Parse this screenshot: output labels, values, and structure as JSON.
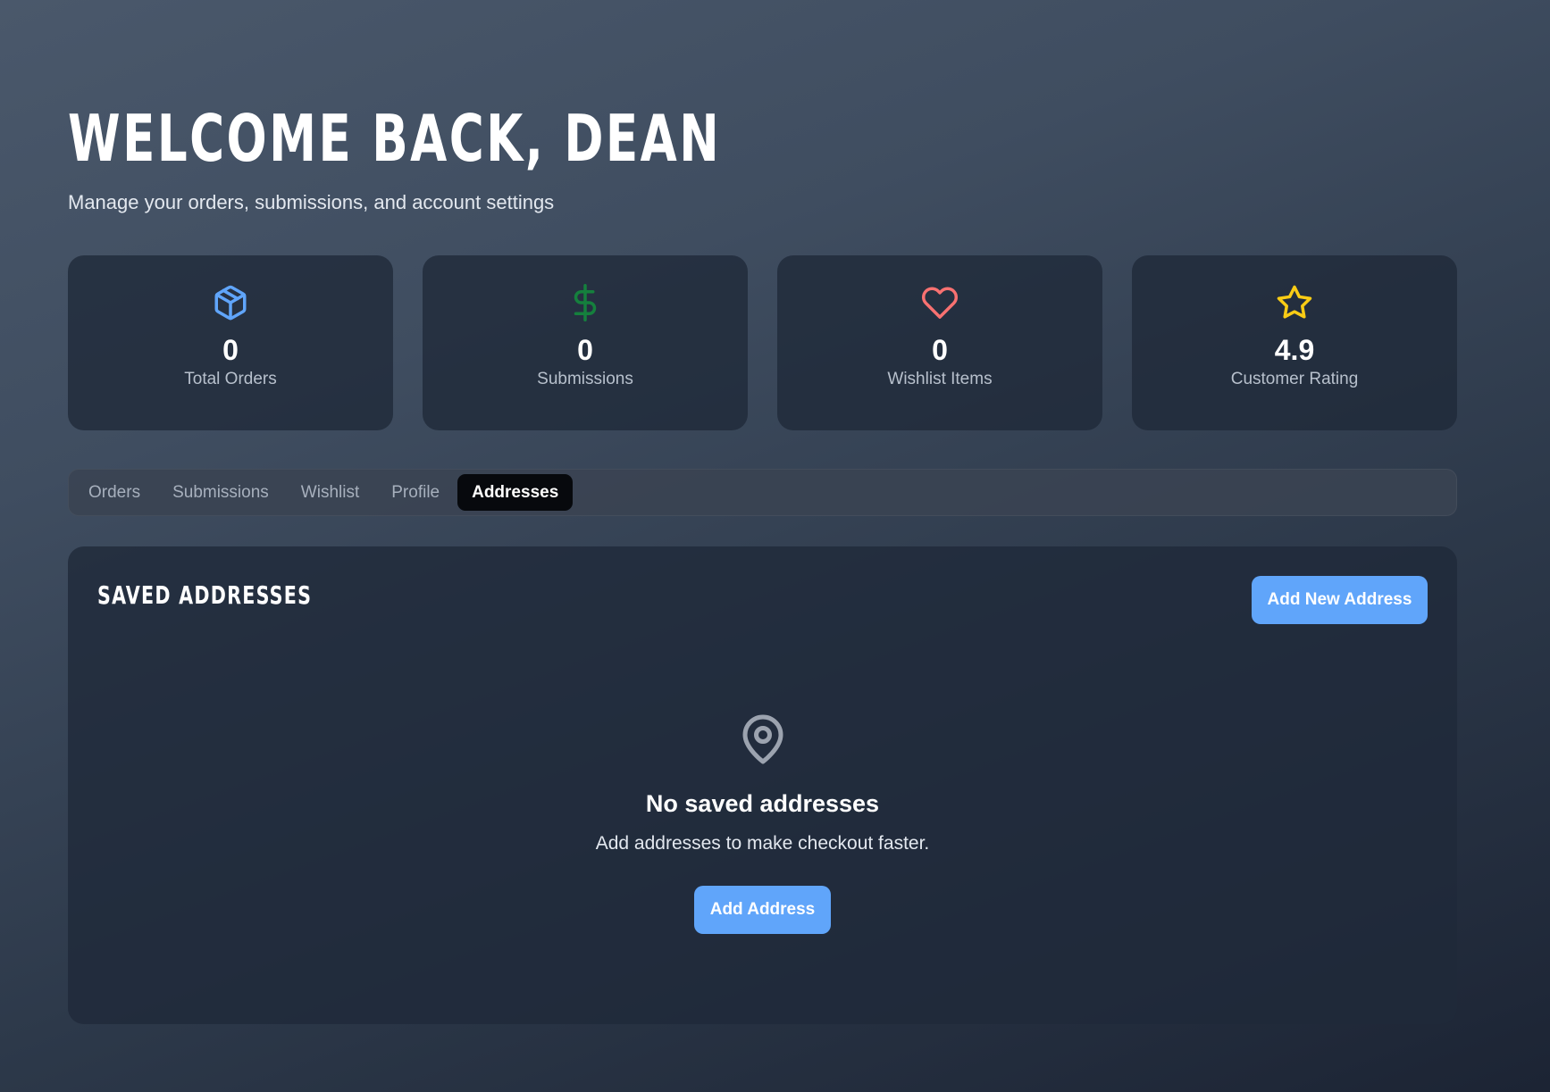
{
  "header": {
    "title": "WELCOME BACK, DEAN",
    "subtitle": "Manage your orders, submissions, and account settings"
  },
  "stats": [
    {
      "icon": "package-icon",
      "color": "#60a5fa",
      "value": "0",
      "label": "Total Orders"
    },
    {
      "icon": "dollar-icon",
      "color": "#15803d",
      "value": "0",
      "label": "Submissions"
    },
    {
      "icon": "heart-icon",
      "color": "#f87171",
      "value": "0",
      "label": "Wishlist Items"
    },
    {
      "icon": "star-icon",
      "color": "#facc15",
      "value": "4.9",
      "label": "Customer Rating"
    }
  ],
  "tabs": [
    {
      "label": "Orders",
      "active": false
    },
    {
      "label": "Submissions",
      "active": false
    },
    {
      "label": "Wishlist",
      "active": false
    },
    {
      "label": "Profile",
      "active": false
    },
    {
      "label": "Addresses",
      "active": true
    }
  ],
  "addresses": {
    "title": "SAVED ADDRESSES",
    "add_new_label": "Add New Address",
    "empty_icon": "map-pin-icon",
    "empty_title": "No saved addresses",
    "empty_text": "Add addresses to make checkout faster.",
    "add_label": "Add Address"
  },
  "colors": {
    "accent": "#60a5fa",
    "active_tab_bg": "#07090d",
    "muted_icon": "#9ca3af"
  }
}
